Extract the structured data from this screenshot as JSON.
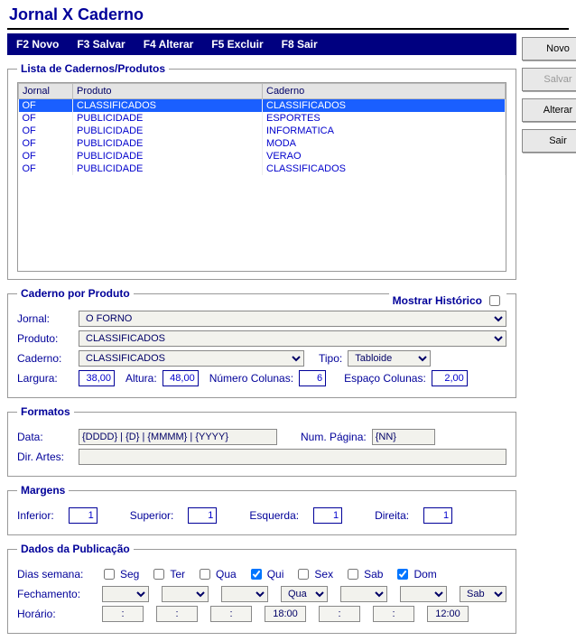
{
  "title": "Jornal X Caderno",
  "fkeys": [
    "F2 Novo",
    "F3 Salvar",
    "F4 Alterar",
    "F5 Excluir",
    "F8 Sair"
  ],
  "buttons": {
    "novo": "Novo",
    "salvar": "Salvar",
    "alterar": "Alterar",
    "sair": "Sair"
  },
  "lista": {
    "legend": "Lista de Cadernos/Produtos",
    "headers": [
      "Jornal",
      "Produto",
      "Caderno"
    ],
    "rows": [
      {
        "jornal": "OF",
        "produto": "CLASSIFICADOS",
        "caderno": "CLASSIFICADOS",
        "selected": true
      },
      {
        "jornal": "OF",
        "produto": "PUBLICIDADE",
        "caderno": "ESPORTES"
      },
      {
        "jornal": "OF",
        "produto": "PUBLICIDADE",
        "caderno": "INFORMATICA"
      },
      {
        "jornal": "OF",
        "produto": "PUBLICIDADE",
        "caderno": "MODA"
      },
      {
        "jornal": "OF",
        "produto": "PUBLICIDADE",
        "caderno": "VERAO"
      },
      {
        "jornal": "OF",
        "produto": "PUBLICIDADE",
        "caderno": "CLASSIFICADOS"
      }
    ]
  },
  "caderno": {
    "legend": "Caderno por Produto",
    "mostrar_hist": "Mostrar Histórico",
    "jornal_lbl": "Jornal:",
    "jornal": "O FORNO",
    "produto_lbl": "Produto:",
    "produto": "CLASSIFICADOS",
    "caderno_lbl": "Caderno:",
    "caderno_val": "CLASSIFICADOS",
    "tipo_lbl": "Tipo:",
    "tipo": "Tabloide",
    "largura_lbl": "Largura:",
    "largura": "38,00",
    "altura_lbl": "Altura:",
    "altura": "48,00",
    "numcol_lbl": "Número Colunas:",
    "numcol": "6",
    "espcol_lbl": "Espaço Colunas:",
    "espcol": "2,00"
  },
  "formatos": {
    "legend": "Formatos",
    "data_lbl": "Data:",
    "data": "{DDDD} | {D} | {MMMM} | {YYYY}",
    "numpag_lbl": "Num. Página:",
    "numpag": "{NN}",
    "dirartes_lbl": "Dir. Artes:",
    "dirartes": ""
  },
  "margens": {
    "legend": "Margens",
    "inferior_lbl": "Inferior:",
    "inferior": "1",
    "superior_lbl": "Superior:",
    "superior": "1",
    "esquerda_lbl": "Esquerda:",
    "esquerda": "1",
    "direita_lbl": "Direita:",
    "direita": "1"
  },
  "pub": {
    "legend": "Dados da Publicação",
    "dias_lbl": "Dias semana:",
    "days": {
      "seg": "Seg",
      "ter": "Ter",
      "qua": "Qua",
      "qui": "Qui",
      "sex": "Sex",
      "sab": "Sab",
      "dom": "Dom"
    },
    "checked": {
      "qui": true,
      "dom": true
    },
    "fech_lbl": "Fechamento:",
    "fech_vals": [
      "",
      "",
      "",
      "Qua",
      "",
      "",
      "Sab"
    ],
    "horario_lbl": "Horário:",
    "horas": [
      ":",
      ":",
      ":",
      "18:00",
      ":",
      ":",
      "12:00"
    ]
  }
}
